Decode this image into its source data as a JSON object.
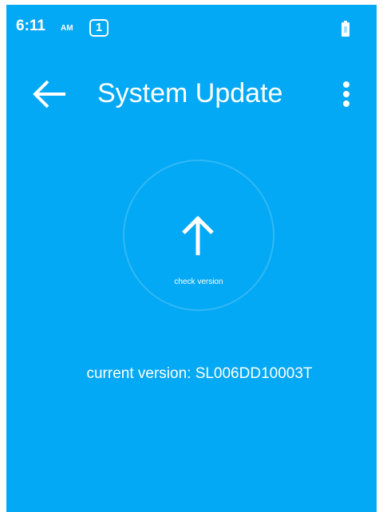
{
  "status_bar": {
    "time": "6:11",
    "ampm": "AM",
    "notification_count": "1",
    "icons": [
      "notification-badge-icon",
      "battery-icon"
    ]
  },
  "app_bar": {
    "title": "System Update",
    "icons": [
      "back-arrow-icon",
      "overflow-menu-icon"
    ]
  },
  "main": {
    "check_button_label": "check version",
    "check_button_icon": "up-arrow-icon",
    "current_version": "current version: SL006DD10003T"
  },
  "colors": {
    "background": "#03A9F4",
    "foreground": "#FFFFFF"
  }
}
